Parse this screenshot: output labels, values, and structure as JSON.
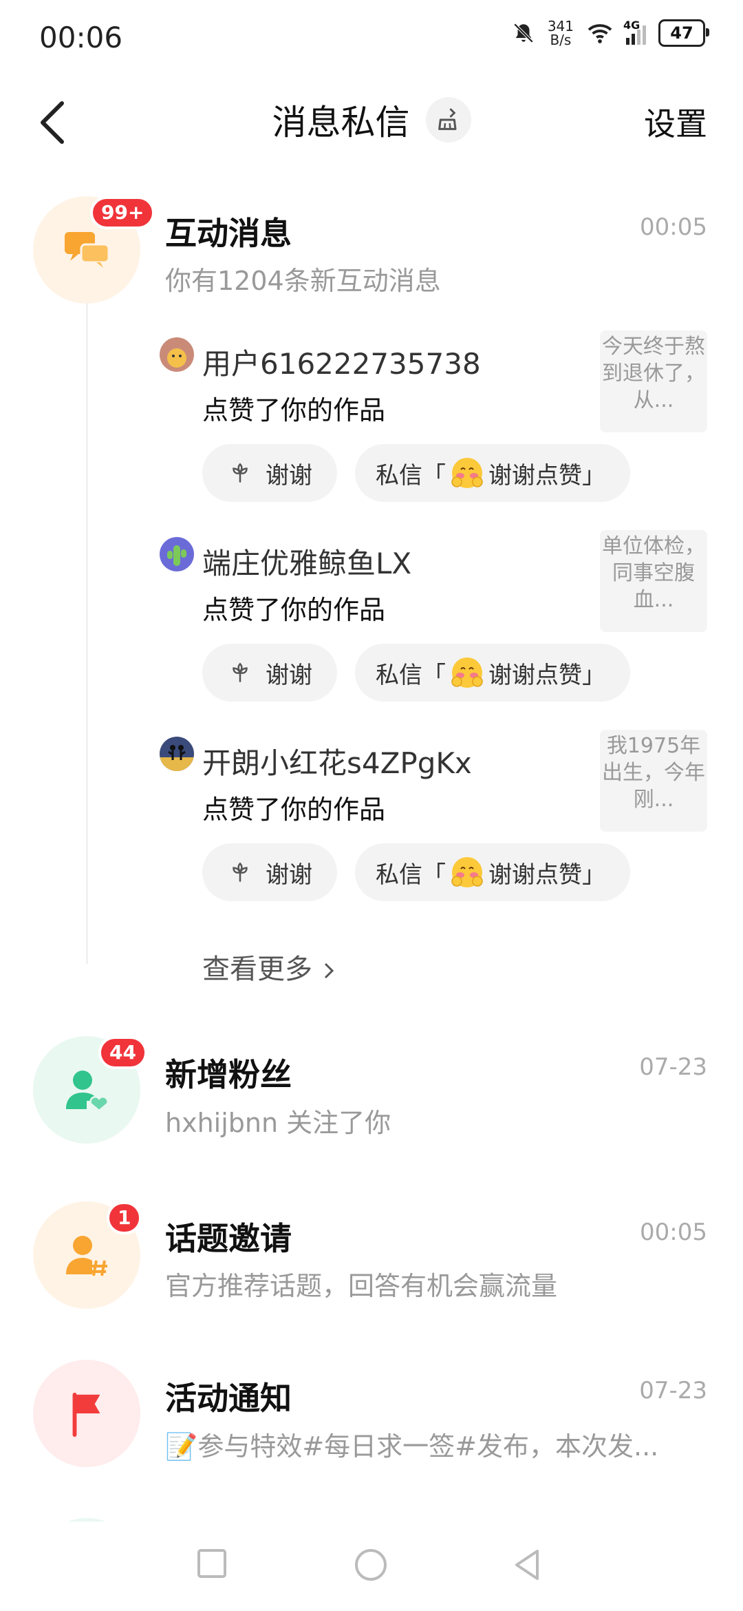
{
  "status_bar": {
    "time": "00:06",
    "net_speed_value": "341",
    "net_speed_unit": "B/s",
    "network": "4G",
    "battery": "47"
  },
  "header": {
    "title": "消息私信",
    "settings": "设置"
  },
  "interactions": {
    "title": "互动消息",
    "subtitle": "你有1204条新互动消息",
    "time": "00:05",
    "badge": "99+",
    "items": [
      {
        "name": "用户616222735738",
        "action": "点赞了你的作品",
        "preview": "今天终于熬到退休了，从...",
        "thanks": "谢谢",
        "dm_prefix": "私信「",
        "dm_text": "谢谢点赞」"
      },
      {
        "name": "端庄优雅鲸鱼LX",
        "action": "点赞了你的作品",
        "preview": "单位体检，同事空腹血...",
        "thanks": "谢谢",
        "dm_prefix": "私信「",
        "dm_text": "谢谢点赞」"
      },
      {
        "name": "开朗小红花s4ZPgKx",
        "action": "点赞了你的作品",
        "preview": "我1975年出生，今年刚...",
        "thanks": "谢谢",
        "dm_prefix": "私信「",
        "dm_text": "谢谢点赞」"
      }
    ],
    "more": "查看更多"
  },
  "followers": {
    "title": "新增粉丝",
    "subtitle": "hxhijbnn 关注了你",
    "time": "07-23",
    "badge": "44"
  },
  "topics": {
    "title": "话题邀请",
    "subtitle": "官方推荐话题，回答有机会赢流量",
    "time": "00:05",
    "badge": "1"
  },
  "activities": {
    "title": "活动通知",
    "subtitle": "📝参与特效#每日求一签#发布，本次发...",
    "time": "07-23"
  },
  "colors": {
    "badge": "#f0343a",
    "orange_bg": "#fff3e6",
    "orange": "#f8a531",
    "green_bg": "#e9f8f1",
    "green": "#31c48d",
    "red_bg": "#ffecec",
    "red": "#f23c3c"
  }
}
